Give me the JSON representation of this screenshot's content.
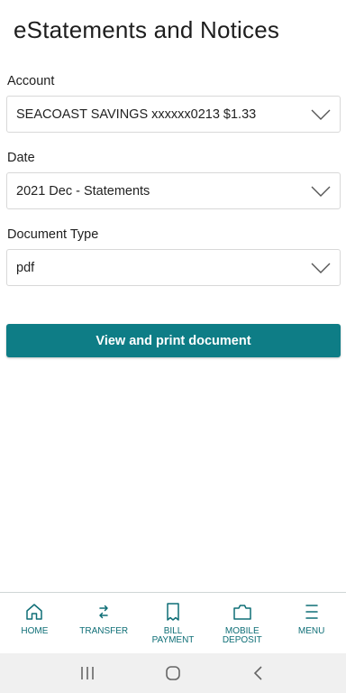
{
  "header": {
    "title": "eStatements and Notices"
  },
  "form": {
    "account": {
      "label": "Account",
      "value": "SEACOAST SAVINGS xxxxxx0213 $1.33"
    },
    "date": {
      "label": "Date",
      "value": "2021 Dec - Statements"
    },
    "document_type": {
      "label": "Document Type",
      "value": "pdf"
    },
    "submit_label": "View and print document"
  },
  "bottom_nav": {
    "items": [
      {
        "label": "HOME",
        "icon": "home-icon"
      },
      {
        "label": "TRANSFER",
        "icon": "transfer-icon"
      },
      {
        "label": "BILL\nPAYMENT",
        "icon": "receipt-icon"
      },
      {
        "label": "MOBILE\nDEPOSIT",
        "icon": "deposit-icon"
      },
      {
        "label": "MENU",
        "icon": "menu-icon"
      }
    ]
  },
  "colors": {
    "accent": "#0e7d86",
    "nav_text": "#0e6e76"
  }
}
